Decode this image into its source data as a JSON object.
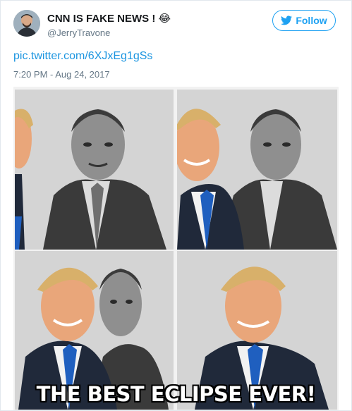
{
  "tweet": {
    "display_name": "CNN IS FAKE NEWS !",
    "name_emoji": "😂",
    "handle": "@JerryTravone",
    "follow_label": "Follow",
    "link_text": "pic.twitter.com/6XJxEg1gSs",
    "timestamp": "7:20 PM - Aug 24, 2017"
  },
  "image": {
    "caption": "THE BEST ECLIPSE EVER!"
  },
  "colors": {
    "accent": "#1da1f2",
    "link": "#1b95e0",
    "muted": "#657786"
  },
  "icons": [
    "twitter-bird-icon"
  ]
}
